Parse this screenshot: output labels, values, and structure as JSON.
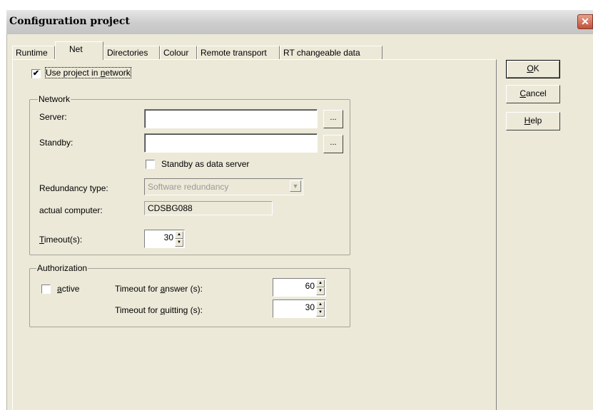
{
  "window": {
    "title": "Configuration project",
    "close_glyph": "✕"
  },
  "tabs": [
    {
      "label": "Runtime",
      "active": false
    },
    {
      "label": "Net",
      "active": true
    },
    {
      "label": "Directories",
      "active": false
    },
    {
      "label": "Colour",
      "active": false
    },
    {
      "label": "Remote transport",
      "active": false
    },
    {
      "label": "RT changeable data",
      "active": false
    }
  ],
  "net": {
    "use_project_in_network": {
      "pre": "Use project in ",
      "mnemonic": "n",
      "post": "etwork",
      "checked": true
    },
    "network_group": {
      "legend": "Network",
      "server_label": "Server:",
      "server_value": "",
      "server_browse": "...",
      "standby_label": "Standby:",
      "standby_value": "",
      "standby_browse": "...",
      "standby_as_data_server": {
        "label": "Standby as data server",
        "checked": false
      },
      "redundancy_type_label": "Redundancy type:",
      "redundancy_type_value": "Software redundancy",
      "actual_computer_label": "actual computer:",
      "actual_computer_value": "CDSBG088",
      "timeout_label_mnemonic": "T",
      "timeout_label_rest": "imeout(s):",
      "timeout_value": "30"
    },
    "authorization_group": {
      "legend": "Authorization",
      "active": {
        "mnemonic": "a",
        "rest": "ctive",
        "checked": false
      },
      "answer_pre": "Timeout for ",
      "answer_mnemonic": "a",
      "answer_post": "nswer (s):",
      "answer_value": "60",
      "quitting_pre": "Timeout for ",
      "quitting_mnemonic": "q",
      "quitting_post": "uitting (s):",
      "quitting_value": "30"
    }
  },
  "buttons": {
    "ok": {
      "mnemonic": "O",
      "rest": "K"
    },
    "cancel": {
      "mnemonic": "C",
      "rest": "ancel"
    },
    "help": {
      "mnemonic": "H",
      "rest": "elp"
    }
  },
  "icons": {
    "checkmark": "✔",
    "spin_up": "▲",
    "spin_down": "▼",
    "dropdown": "▼"
  }
}
